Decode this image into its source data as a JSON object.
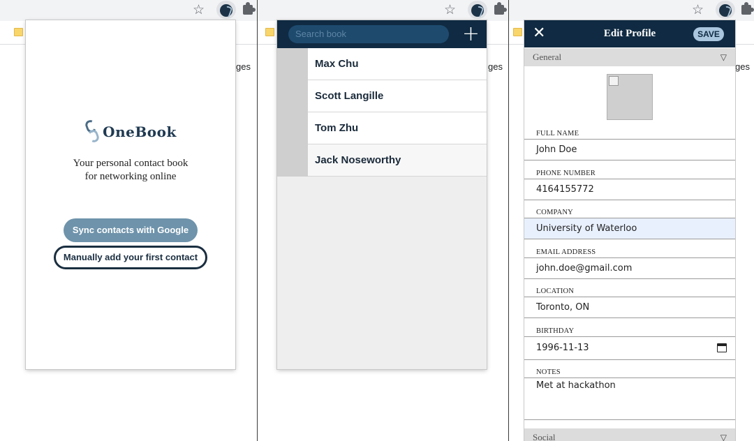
{
  "screens": {
    "onboarding": {
      "background_text": "ges",
      "logo_text": "OneBook",
      "tagline_line1": "Your personal contact book",
      "tagline_line2": "for networking online",
      "sync_button": "Sync contacts with Google",
      "manual_button": "Manually add your first contact"
    },
    "contacts": {
      "background_text": "ges",
      "search_placeholder": "Search book",
      "add_icon": "plus-icon",
      "contacts": [
        {
          "name": "Max Chu"
        },
        {
          "name": "Scott Langille"
        },
        {
          "name": "Tom Zhu"
        },
        {
          "name": "Jack Noseworthy"
        }
      ]
    },
    "edit_profile": {
      "background_text": "ges",
      "title": "Edit Profile",
      "save_label": "SAVE",
      "general_section": "General",
      "social_section": "Social",
      "fields": {
        "full_name": {
          "label": "FULL NAME",
          "value": "John Doe"
        },
        "phone": {
          "label": "PHONE NUMBER",
          "value": "4164155772"
        },
        "company": {
          "label": "COMPANY",
          "value": "University of Waterloo"
        },
        "email": {
          "label": "EMAIL ADDRESS",
          "value": "john.doe@gmail.com"
        },
        "location": {
          "label": "LOCATION",
          "value": "Toronto, ON"
        },
        "birthday": {
          "label": "BIRTHDAY",
          "value": "1996-11-13"
        },
        "notes": {
          "label": "NOTES",
          "value": "Met at hackathon"
        }
      }
    }
  },
  "colors": {
    "navy": "#0f2a42",
    "sync_button": "#6e93ab",
    "save_button": "#a9c6de",
    "section_header": "#dcdcdc",
    "highlight_input": "#e8f0fe"
  },
  "icons": [
    "star-icon",
    "onebook-extension-icon",
    "puzzle-extensions-icon",
    "folder-icon",
    "close-icon",
    "chevron-down-icon",
    "calendar-icon",
    "plus-icon"
  ]
}
